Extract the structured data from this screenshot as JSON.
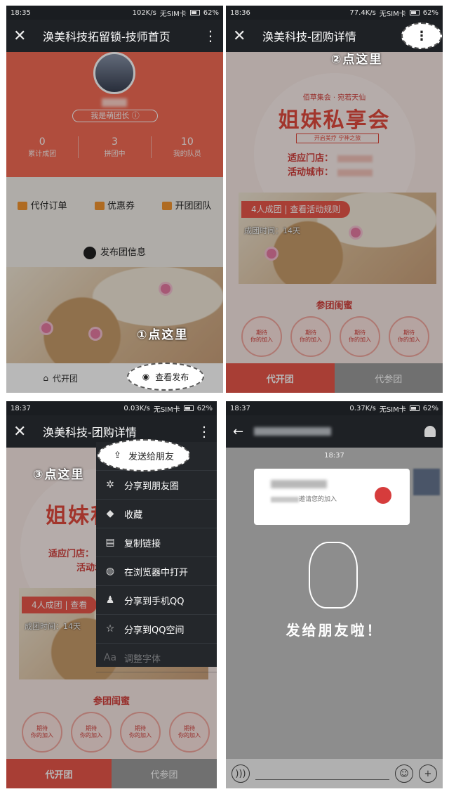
{
  "panel1": {
    "status": {
      "time": "18:35",
      "speed": "102K/s",
      "sim": "无SIM卡",
      "battery": "62%"
    },
    "title": "涣美科技拓留锁-技师首页",
    "leader_badge": "我是萌团长",
    "stats": [
      {
        "num": "0",
        "label": "累计成团"
      },
      {
        "num": "3",
        "label": "拼团中"
      },
      {
        "num": "10",
        "label": "我的队员"
      }
    ],
    "menu": [
      "代付订单",
      "优惠券",
      "开团团队"
    ],
    "publish": "发布团信息",
    "bottom_left": "代开团",
    "bottom_right": "查看发布",
    "callout": "①点这里"
  },
  "panel2": {
    "status": {
      "time": "18:36",
      "speed": "77.4K/s",
      "sim": "无SIM卡",
      "battery": "62%"
    },
    "title": "涣美科技-团购详情",
    "callout": "②点这里",
    "poster": {
      "brand": "佰草集会 · 宛若天仙",
      "headline": "姐妹私享会",
      "sub": "开启美疗   宁神之旅",
      "store_label": "适应门店：",
      "city_label": "活动城市："
    },
    "rule_tag": "4人成团  |  查看活动规则",
    "time_label": "成团时间：14天",
    "members_title": "参团闺蜜",
    "slot_text": "期待\n你的加入",
    "btn_left": "代开团",
    "btn_right": "代参团"
  },
  "panel3": {
    "status": {
      "time": "18:37",
      "speed": "0.03K/s",
      "sim": "无SIM卡",
      "battery": "62%"
    },
    "title": "涣美科技-团购详情",
    "callout": "③点这里",
    "menu": [
      {
        "label": "发送给朋友",
        "icon": "share-icon"
      },
      {
        "label": "分享到朋友圈",
        "icon": "moments-icon"
      },
      {
        "label": "收藏",
        "icon": "cube-icon"
      },
      {
        "label": "复制链接",
        "icon": "document-icon"
      },
      {
        "label": "在浏览器中打开",
        "icon": "globe-icon"
      },
      {
        "label": "分享到手机QQ",
        "icon": "qq-icon"
      },
      {
        "label": "分享到QQ空间",
        "icon": "star-icon"
      },
      {
        "label": "调整字体",
        "icon": "font-icon"
      }
    ],
    "members_title": "参团闺蜜",
    "rule_tag": "4人成团  |  查看",
    "time_label": "成团时间：14天",
    "slot_text": "期待\n你的加入",
    "btn_left": "代开团",
    "btn_right": "代参团"
  },
  "panel4": {
    "status": {
      "time": "18:37",
      "speed": "0.37K/s",
      "sim": "无SIM卡",
      "battery": "62%"
    },
    "chat_time": "18:37",
    "card_desc": "邀请您的加入",
    "send_text": "发给朋友啦！"
  }
}
